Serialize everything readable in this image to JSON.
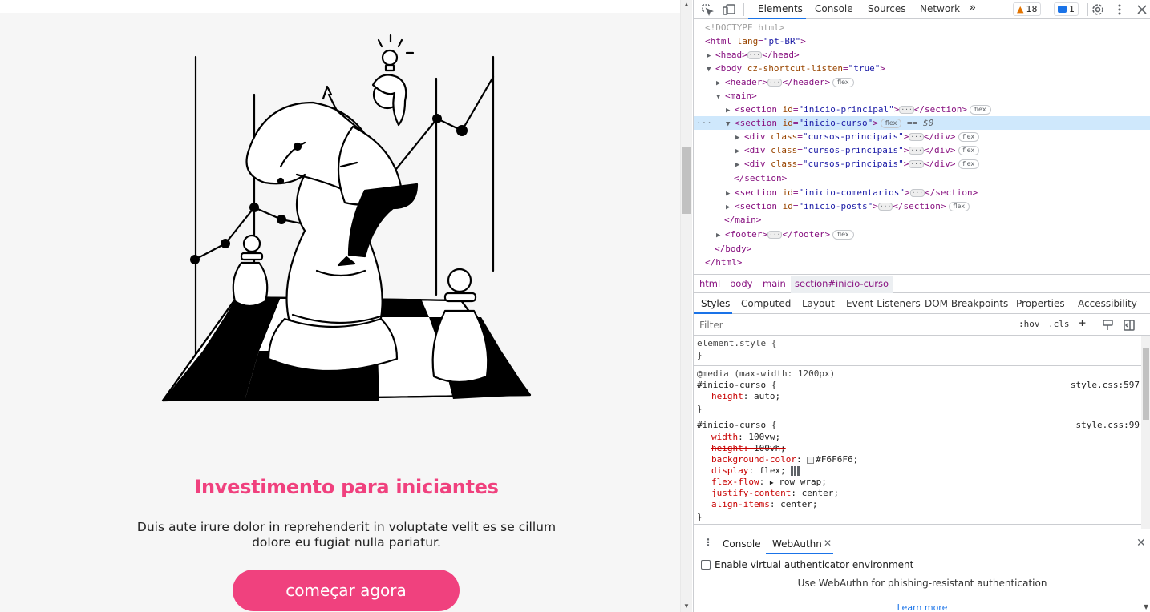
{
  "page": {
    "course_title": "Investimento para iniciantes",
    "course_description": "Duis aute irure dolor in reprehenderit in voluptate velit es se cillum dolore eu fugiat nulla pariatur.",
    "cta_label": "começar agora",
    "accent_color": "#f0417e",
    "background_color": "#F6F6F6"
  },
  "devtools": {
    "tabs": [
      "Elements",
      "Console",
      "Sources",
      "Network"
    ],
    "more_tabs_icon": "chevron-double-right-icon",
    "warnings_count": "18",
    "messages_count": "1",
    "dom": {
      "doctype": "<!DOCTYPE html>",
      "html_open_tag": "html",
      "html_attr": "lang",
      "html_attr_val": "\"pt-BR\"",
      "head": "head",
      "body_tag": "body",
      "body_attr": "cz-shortcut-listen",
      "body_attr_val": "\"true\"",
      "header": "header",
      "main": "main",
      "section": "section",
      "id_attr": "id",
      "section1_id": "\"inicio-principal\"",
      "section2_id": "\"inicio-curso\"",
      "div": "div",
      "class_attr": "class",
      "div_class": "\"cursos-principais\"",
      "section3_id": "\"inicio-comentarios\"",
      "section4_id": "\"inicio-posts\"",
      "footer": "footer",
      "flex_pill": "flex",
      "selected_marker": "== $0",
      "close_section": "</section>",
      "close_main": "</main>",
      "close_body": "</body>",
      "close_html": "</html>"
    },
    "breadcrumbs": [
      "html",
      "body",
      "main",
      "section#inicio-curso"
    ],
    "sub_tabs": [
      "Styles",
      "Computed",
      "Layout",
      "Event Listeners",
      "DOM Breakpoints",
      "Properties",
      "Accessibility"
    ],
    "filter_placeholder": "Filter",
    "hov_label": ":hov",
    "cls_label": ".cls",
    "styles": {
      "element_style": "element.style {",
      "close_brace": "}",
      "media": "@media (max-width: 1200px)",
      "selector": "#inicio-curso {",
      "rule1_source": "style.css:597",
      "rule1_prop": "height",
      "rule1_val": "auto;",
      "rule2_source": "style.css:99",
      "props": [
        {
          "name": "width",
          "value": "100vw;"
        },
        {
          "name": "height",
          "value": "100vh;"
        },
        {
          "name": "background-color",
          "value": "#F6F6F6;"
        },
        {
          "name": "display",
          "value": "flex;"
        },
        {
          "name": "flex-flow",
          "value": "row wrap;"
        },
        {
          "name": "justify-content",
          "value": "center;"
        },
        {
          "name": "align-items",
          "value": "center;"
        }
      ]
    },
    "drawer": {
      "tabs": [
        "Console",
        "WebAuthn"
      ],
      "checkbox_label": "Enable virtual authenticator environment",
      "info": "Use WebAuthn for phishing-resistant authentication",
      "learn_more": "Learn more"
    }
  }
}
